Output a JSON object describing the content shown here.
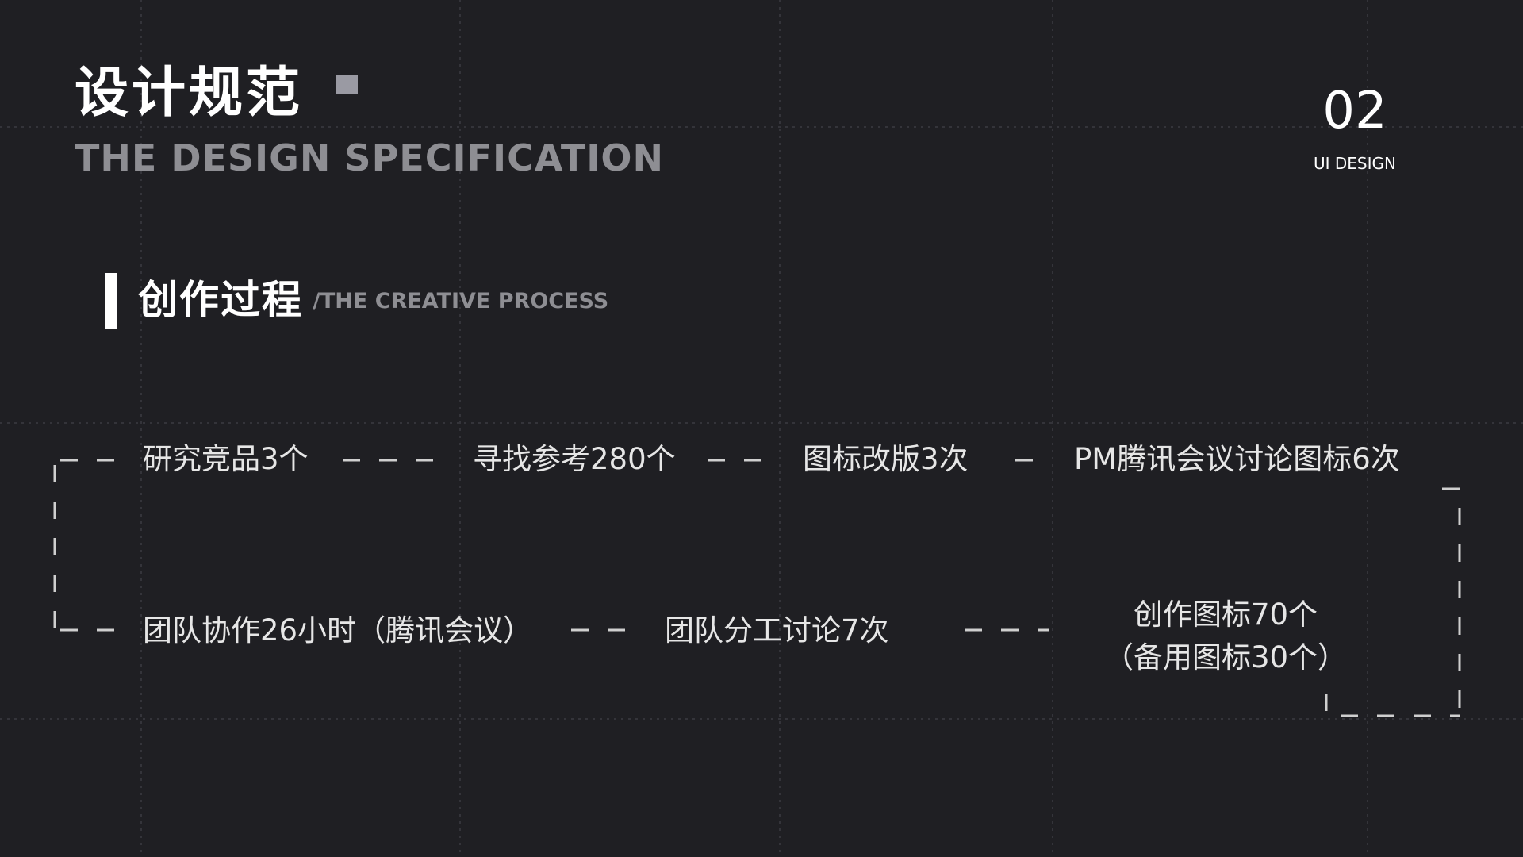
{
  "header": {
    "title_zh": "设计规范",
    "title_en": "THE DESIGN SPECIFICATION",
    "page_number": "02",
    "page_caption": "UI DESIGN"
  },
  "section": {
    "title_zh": "创作过程",
    "title_en": "/THE CREATIVE PROCESS"
  },
  "process_steps": [
    "研究竞品3个",
    "寻找参考280个",
    "图标改版3次",
    "PM腾讯会议讨论图标6次",
    "团队协作26小时（腾讯会议）",
    "团队分工讨论7次"
  ],
  "final_step": {
    "line1": "创作图标70个",
    "line2": "（备用图标30个）"
  },
  "colors": {
    "background": "#1f1f23",
    "grid": "#34343a",
    "primary_text": "#ffffff",
    "secondary_text": "#8e8e93",
    "dash": "#cfcfcf",
    "square_accent": "#9a9aa3"
  }
}
